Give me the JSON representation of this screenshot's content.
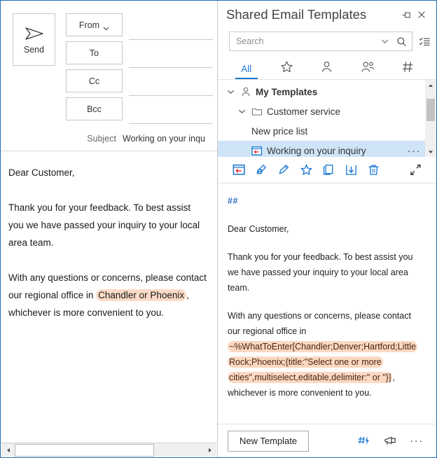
{
  "compose": {
    "send_label": "Send",
    "send_icon": "paper-plane-icon",
    "buttons": [
      {
        "label": "From",
        "has_chevron": true,
        "name": "from-button"
      },
      {
        "label": "To",
        "has_chevron": false,
        "name": "to-button"
      },
      {
        "label": "Cc",
        "has_chevron": false,
        "name": "cc-button"
      },
      {
        "label": "Bcc",
        "has_chevron": false,
        "name": "bcc-button"
      }
    ],
    "subject_label": "Subject",
    "subject_value": "Working on your inqu",
    "body": {
      "greeting": "Dear Customer,",
      "paragraph1": "Thank you for your feedback. To best assist you we have passed your inquiry to your local area team.",
      "p2_before": "With any questions or concerns, please contact our regional office in ",
      "p2_highlight": "Chandler or Phoenix",
      "p2_after": ", whichever is more convenient to you."
    },
    "highlight_color": "#fbdbc7"
  },
  "panel": {
    "title": "Shared Email Templates",
    "pin_icon": "pin-icon",
    "close_icon": "close-icon",
    "search": {
      "placeholder": "Search",
      "value": "",
      "dropdown_icon": "chevron-down-icon",
      "search_icon": "magnifier-icon",
      "list_icon": "checklist-icon"
    },
    "tabs": [
      {
        "label": "All",
        "icon": "",
        "active": true,
        "name": "tab-all"
      },
      {
        "label": "",
        "icon": "star-icon",
        "active": false,
        "name": "tab-favorites"
      },
      {
        "label": "",
        "icon": "person-icon",
        "active": false,
        "name": "tab-my-templates"
      },
      {
        "label": "",
        "icon": "people-icon",
        "active": false,
        "name": "tab-team-templates"
      },
      {
        "label": "",
        "icon": "hash-icon",
        "active": false,
        "name": "tab-tags"
      }
    ],
    "accent_color": "#1976d2",
    "tree": [
      {
        "label": "My Templates",
        "level": 1,
        "expanded": true,
        "icon": "person-icon",
        "bold": true,
        "selected": false
      },
      {
        "label": "Customer service",
        "level": 2,
        "expanded": true,
        "icon": "folder-icon",
        "bold": false,
        "selected": false
      },
      {
        "label": "New price list",
        "level": 3,
        "expanded": null,
        "icon": "",
        "bold": false,
        "selected": false
      },
      {
        "label": "Working on your inquiry",
        "level": 3,
        "expanded": null,
        "icon": "template-insert-icon",
        "bold": false,
        "selected": true,
        "overflow": "···"
      }
    ],
    "toolbar": [
      {
        "name": "insert-template-icon"
      },
      {
        "name": "insert-as-link-icon"
      },
      {
        "name": "edit-icon"
      },
      {
        "name": "favorite-star-icon"
      },
      {
        "name": "copy-icon"
      },
      {
        "name": "save-icon"
      },
      {
        "name": "delete-icon"
      },
      {
        "name": "expand-icon"
      }
    ],
    "preview": {
      "hashes": "##",
      "greeting": "Dear Customer,",
      "paragraph1": "Thank you for your feedback. To best assist you we have passed your inquiry to your local area team.",
      "p2_before": "With any questions or concerns, please contact our regional office in ",
      "p2_macro": "~%WhatToEnter[Chandler;Denver;Hartford;Little Rock;Phoenix;{title:\"Select one or more cities\",multiselect,editable,delimiter:\" or \"}]",
      "p2_after": ", whichever is more convenient to you.",
      "macro_color": "#fbd8c2"
    },
    "footer": {
      "new_template_label": "New Template",
      "icons": [
        {
          "name": "hash-lightning-icon"
        },
        {
          "name": "megaphone-icon"
        },
        {
          "name": "more-options-icon"
        }
      ]
    }
  }
}
